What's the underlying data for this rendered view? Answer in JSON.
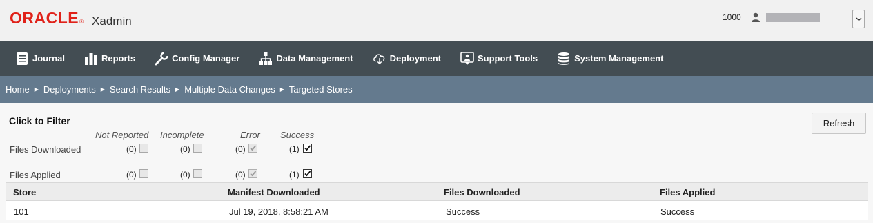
{
  "header": {
    "brand": "ORACLE",
    "brand_mark": "®",
    "app_name": "Xadmin",
    "store_number": "1000"
  },
  "nav": {
    "items": [
      {
        "label": "Journal",
        "icon": "journal-icon"
      },
      {
        "label": "Reports",
        "icon": "reports-icon"
      },
      {
        "label": "Config Manager",
        "icon": "wrench-icon"
      },
      {
        "label": "Data Management",
        "icon": "hierarchy-icon"
      },
      {
        "label": "Deployment",
        "icon": "cloud-download-icon"
      },
      {
        "label": "Support Tools",
        "icon": "support-icon"
      },
      {
        "label": "System Management",
        "icon": "database-icon"
      }
    ]
  },
  "breadcrumb": [
    "Home",
    "Deployments",
    "Search Results",
    "Multiple Data Changes",
    "Targeted Stores"
  ],
  "filter": {
    "title": "Click to Filter",
    "columns": [
      "Not Reported",
      "Incomplete",
      "Error",
      "Success"
    ],
    "rows": [
      {
        "label": "Files Downloaded",
        "counts": [
          "(0)",
          "(0)",
          "(0)",
          "(1)"
        ],
        "checked": [
          false,
          false,
          true,
          true
        ],
        "enabled": [
          false,
          false,
          false,
          true
        ]
      },
      {
        "label": "Files Applied",
        "counts": [
          "(0)",
          "(0)",
          "(0)",
          "(1)"
        ],
        "checked": [
          false,
          false,
          true,
          true
        ],
        "enabled": [
          false,
          false,
          false,
          true
        ]
      }
    ]
  },
  "refresh_label": "Refresh",
  "table": {
    "headers": [
      "Store",
      "Manifest Downloaded",
      "Files Downloaded",
      "Files Applied"
    ],
    "rows": [
      [
        "101",
        "Jul 19, 2018, 8:58:21 AM",
        "Success",
        "Success"
      ]
    ]
  },
  "colors": {
    "brand_red": "#e0221a",
    "nav_bg": "#434d53",
    "breadcrumb_bg": "#647a8e"
  }
}
